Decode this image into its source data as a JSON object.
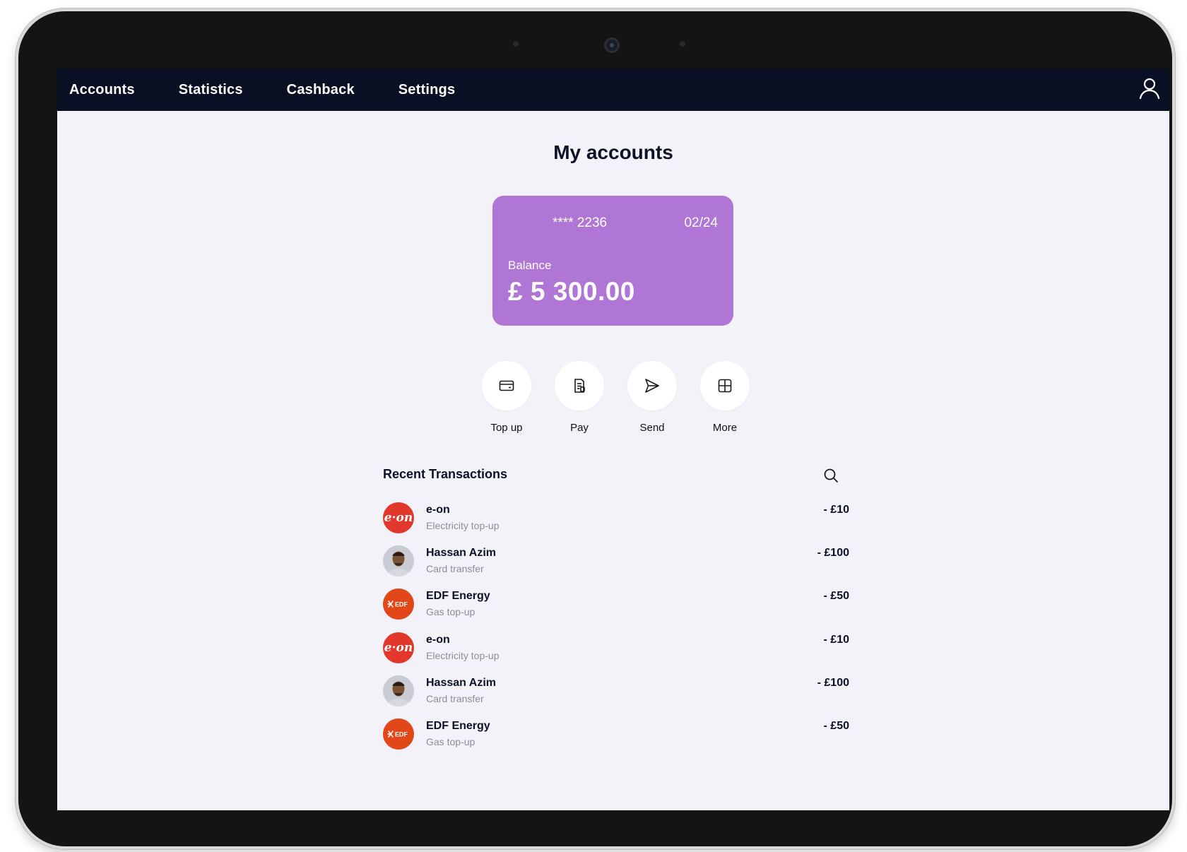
{
  "nav": {
    "items": [
      "Accounts",
      "Statistics",
      "Cashback",
      "Settings"
    ]
  },
  "page": {
    "title": "My accounts"
  },
  "card": {
    "number": "**** 2236",
    "expiry": "02/24",
    "balance_label": "Balance",
    "balance": "£ 5 300.00",
    "color": "#b076d6"
  },
  "actions": [
    {
      "label": "Top up",
      "icon": "card-icon"
    },
    {
      "label": "Pay",
      "icon": "receipt-icon"
    },
    {
      "label": "Send",
      "icon": "send-icon"
    },
    {
      "label": "More",
      "icon": "grid-icon"
    }
  ],
  "transactions": {
    "title": "Recent Transactions",
    "items": [
      {
        "name": "e-on",
        "description": "Electricity top-up",
        "amount": "- £10",
        "logo": "e-on"
      },
      {
        "name": "Hassan Azim",
        "description": "Card transfer",
        "amount": "- £100",
        "logo": "avatar"
      },
      {
        "name": "EDF Energy",
        "description": "Gas top-up",
        "amount": "- £50",
        "logo": "edf"
      },
      {
        "name": "e-on",
        "description": "Electricity top-up",
        "amount": "- £10",
        "logo": "e-on"
      },
      {
        "name": "Hassan Azim",
        "description": "Card transfer",
        "amount": "- £100",
        "logo": "avatar"
      },
      {
        "name": "EDF Energy",
        "description": "Gas top-up",
        "amount": "- £50",
        "logo": "edf"
      }
    ]
  },
  "colors": {
    "nav_bg": "#0a1024",
    "screen_bg": "#f2f2f8",
    "eon_red": "#e2382b",
    "edf_orange": "#e2471a"
  }
}
